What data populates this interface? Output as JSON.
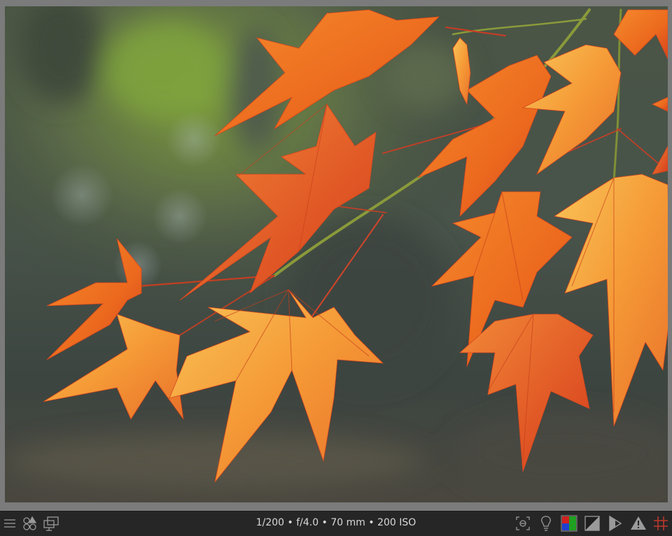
{
  "photo": {
    "subject": "red-orange maple leaves on a branch against a blurred background"
  },
  "statusbar": {
    "exif": {
      "shutter": "1/200",
      "aperture": "f/4.0",
      "focal_length": "70 mm",
      "iso": "200 ISO",
      "separator": " • "
    },
    "left_icons": [
      "hamburger-menu-icon",
      "color-picker-icon",
      "display-profile-icon"
    ],
    "right_icons": [
      "focus-mask-icon",
      "bulb-icon",
      "color-channels-icon",
      "clipping-icon",
      "softproof-icon",
      "gamut-warning-icon",
      "guides-icon"
    ]
  },
  "colors": {
    "statusbar_bg": "#262626",
    "viewer_bg": "#7b7b7b",
    "leaf_orange": "#f07a24",
    "leaf_red": "#d8421c",
    "leaf_yellow": "#f7b84a"
  }
}
